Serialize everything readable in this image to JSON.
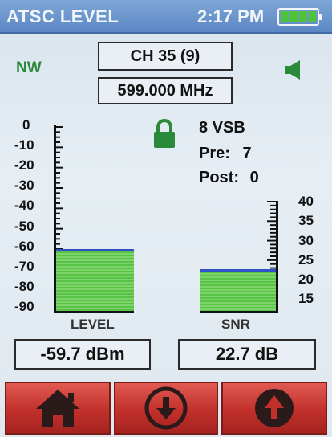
{
  "header": {
    "title": "ATSC LEVEL",
    "time": "2:17 PM",
    "battery_level": 1.0
  },
  "channel": {
    "channel_label": "CH 35 (9)",
    "frequency": "599.000 MHz",
    "direction": "NW"
  },
  "signal_info": {
    "modulation": "8 VSB",
    "pre_label": "Pre:",
    "pre_value": "7",
    "post_label": "Post:",
    "post_value": "0",
    "locked": true
  },
  "level_meter": {
    "name": "LEVEL",
    "scale": [
      "0",
      "-10",
      "-20",
      "-30",
      "-40",
      "-50",
      "-60",
      "-70",
      "-80",
      "-90"
    ],
    "min": -90,
    "max": 0,
    "value": -59.7,
    "readout": "-59.7 dBm"
  },
  "snr_meter": {
    "name": "SNR",
    "scale": [
      "40",
      "35",
      "30",
      "25",
      "20",
      "15"
    ],
    "min": 12,
    "max": 40,
    "value": 22.7,
    "readout": "22.7 dB"
  },
  "colors": {
    "title_bar": "#5b87c4",
    "bar_fill": "#58c247",
    "bar_top": "#2f52c8",
    "button": "#c2302b",
    "direction_text": "#2a8a3a"
  },
  "buttons": [
    {
      "icon": "home-icon"
    },
    {
      "icon": "down-arrow-icon"
    },
    {
      "icon": "up-arrow-icon"
    }
  ]
}
